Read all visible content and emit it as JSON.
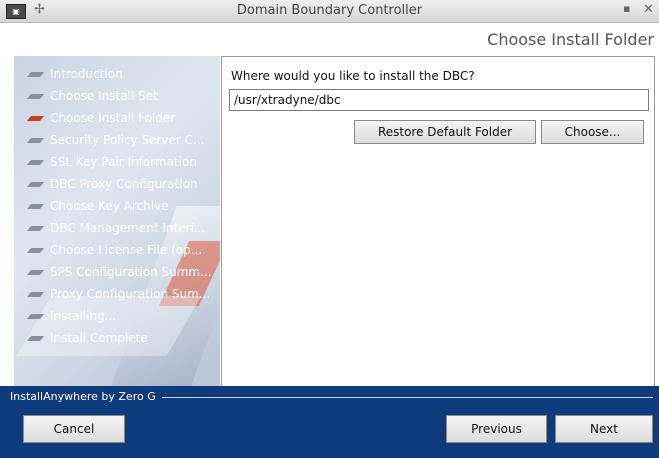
{
  "window": {
    "title": "Domain Boundary Controller",
    "app_icon": "terminal-app-icon",
    "pin_glyph": "✢",
    "minimize_glyph": "▪",
    "close_glyph": "✕"
  },
  "header": {
    "step_title": "Choose Install Folder"
  },
  "sidebar": {
    "steps": [
      {
        "label": "Introduction",
        "state": "done"
      },
      {
        "label": "Choose Install Set",
        "state": "done"
      },
      {
        "label": "Choose Install Folder",
        "state": "current"
      },
      {
        "label": "Security Policy Server C...",
        "state": "pending"
      },
      {
        "label": "SSL Key Pair Information",
        "state": "pending"
      },
      {
        "label": "DBC Proxy Configuration",
        "state": "pending"
      },
      {
        "label": "Choose Key Archive",
        "state": "pending"
      },
      {
        "label": "DBC Management Interf...",
        "state": "pending"
      },
      {
        "label": "Choose License File (op...",
        "state": "pending"
      },
      {
        "label": "SPS Configuration Summ...",
        "state": "pending"
      },
      {
        "label": "Proxy Configuration Sum...",
        "state": "pending"
      },
      {
        "label": "Installing...",
        "state": "pending"
      },
      {
        "label": "Install Complete",
        "state": "pending"
      }
    ]
  },
  "main": {
    "prompt": "Where would you like to install the DBC?",
    "install_path": "/usr/xtradyne/dbc",
    "restore_label": "Restore Default Folder",
    "choose_label": "Choose..."
  },
  "footer": {
    "brand": "InstallAnywhere by Zero G",
    "cancel_label": "Cancel",
    "previous_label": "Previous",
    "next_label": "Next"
  },
  "colors": {
    "footer_bg": "#0f3a7c",
    "current_step_bullet": "#cc3a1f",
    "step_bullet": "#8a8f9a"
  }
}
